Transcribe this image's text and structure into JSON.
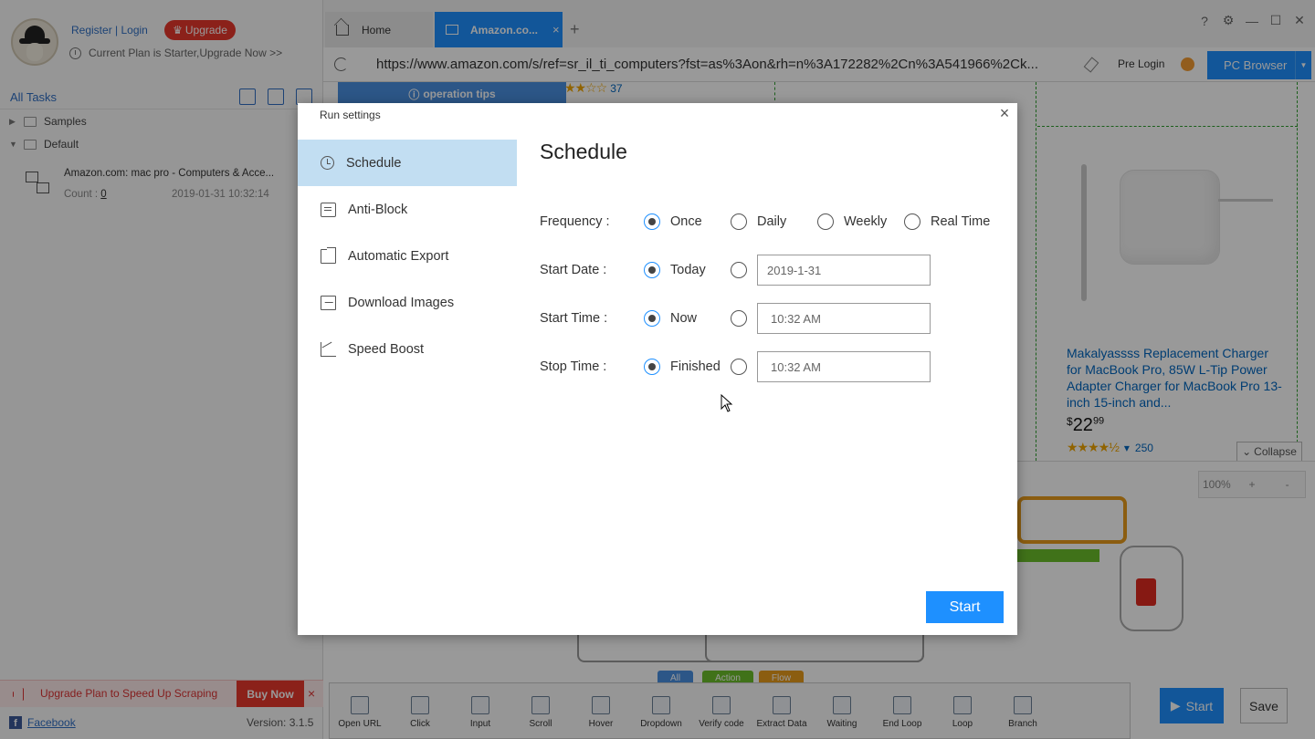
{
  "user": {
    "register_login": "Register | Login",
    "upgrade": "Upgrade",
    "plan_text": "Current Plan is Starter,Upgrade Now >>"
  },
  "sidebar": {
    "all_tasks": "All Tasks",
    "groups": [
      {
        "label": "Samples"
      },
      {
        "label": "Default"
      }
    ],
    "task": {
      "title": "Amazon.com: mac pro - Computers & Acce...",
      "count_label": "Count :",
      "count": "0",
      "date": "2019-01-31 10:32:14"
    },
    "promo": {
      "text": "Upgrade Plan to Speed Up Scraping",
      "buy_now": "Buy Now",
      "close": "×"
    },
    "facebook": "Facebook",
    "version": "Version: 3.1.5"
  },
  "browser": {
    "tabs": [
      {
        "label": "Home"
      },
      {
        "label": "Amazon.co..."
      }
    ],
    "close_tab": "×",
    "new_tab": "+",
    "url": "https://www.amazon.com/s/ref=sr_il_ti_computers?fst=as%3Aon&rh=n%3A172282%2Cn%3A541966%2Ck...",
    "pre_login": "Pre Login",
    "pc_browser": "PC Browser",
    "window_controls": [
      "?",
      "⚙",
      "—",
      "☐",
      "✕"
    ]
  },
  "webpage": {
    "operation_tips": "operation tips",
    "top_rating_count": "37",
    "product": {
      "title": "Makalyassss Replacement Charger for MacBook Pro, 85W L-Tip Power Adapter Charger for MacBook Pro 13-inch 15-inch and...",
      "price_currency": "$",
      "price_whole": "22",
      "price_fraction": "99",
      "rating": 4.5,
      "rating_count": "250"
    },
    "collapse": "Collapse"
  },
  "workflow": {
    "zoom": "100%",
    "zoom_in": "+",
    "zoom_out": "-",
    "categories": [
      {
        "label": "All",
        "color": "#4a90e2"
      },
      {
        "label": "Action",
        "color": "#6bbf2a"
      },
      {
        "label": "Flow",
        "color": "#e89b1c"
      }
    ],
    "tools": [
      "Open URL",
      "Click",
      "Input",
      "Scroll",
      "Hover",
      "Dropdown",
      "Verify code",
      "Extract Data",
      "Waiting",
      "End Loop",
      "Loop",
      "Branch"
    ],
    "start": "Start",
    "save": "Save"
  },
  "modal": {
    "title": "Run settings",
    "close": "×",
    "nav": [
      {
        "label": "Schedule",
        "icon": "alarm-icon",
        "active": true
      },
      {
        "label": "Anti-Block",
        "icon": "shield-icon",
        "active": false
      },
      {
        "label": "Automatic Export",
        "icon": "export-icon",
        "active": false
      },
      {
        "label": "Download Images",
        "icon": "image-icon",
        "active": false
      },
      {
        "label": "Speed Boost",
        "icon": "speed-icon",
        "active": false
      }
    ],
    "content_title": "Schedule",
    "frequency": {
      "label": "Frequency :",
      "options": [
        "Once",
        "Daily",
        "Weekly",
        "Real Time"
      ],
      "selected": "Once"
    },
    "start_date": {
      "label": "Start Date :",
      "option": "Today",
      "value": "2019-1-31"
    },
    "start_time": {
      "label": "Start Time :",
      "option": "Now",
      "value": "10:32  AM"
    },
    "stop_time": {
      "label": "Stop Time :",
      "option": "Finished",
      "value": "10:32  AM"
    },
    "start_button": "Start"
  },
  "colors": {
    "accent": "#1e90ff",
    "nav_active": "#c2def2",
    "upgrade_red": "#e8382c",
    "link_blue": "#2f6fc4"
  }
}
